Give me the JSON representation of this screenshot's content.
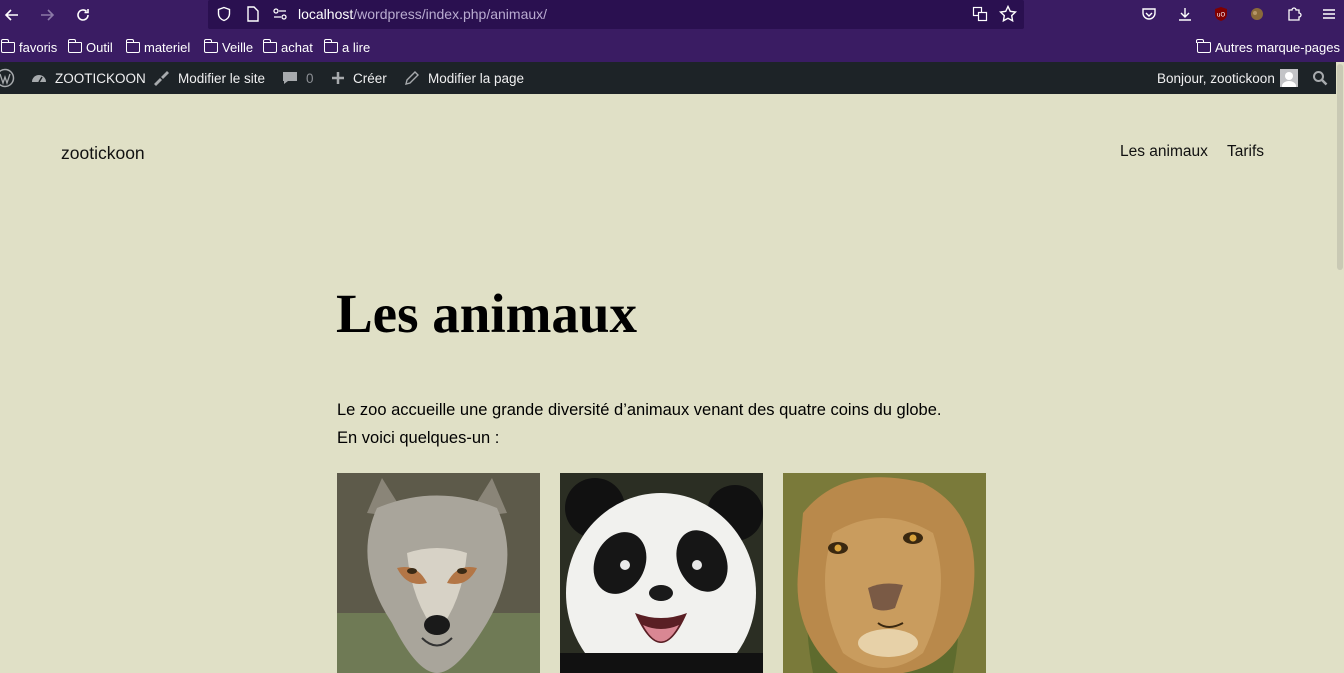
{
  "browser": {
    "url_host": "localhost",
    "url_path": "/wordpress/index.php/animaux/",
    "bookmarks": [
      "favoris",
      "Outil",
      "materiel",
      "Veille",
      "achat",
      "a lire"
    ],
    "other_bookmarks": "Autres marque-pages"
  },
  "adminbar": {
    "site_name": "ZOOTICKOON",
    "edit_site": "Modifier le site",
    "comments_count": "0",
    "new": "Créer",
    "edit_page": "Modifier la page",
    "greeting": "Bonjour, zootickoon"
  },
  "site": {
    "title": "zootickoon",
    "nav": [
      "Les animaux",
      "Tarifs"
    ]
  },
  "page": {
    "title": "Les animaux",
    "intro_line1": "Le zoo accueille une grande diversité d’animaux venant des quatre coins du globe.",
    "intro_line2": "En voici quelques-un :",
    "gallery": [
      "wolf-photo",
      "panda-photo",
      "lion-photo"
    ]
  },
  "colors": {
    "browser_chrome": "#3a1c63",
    "adminbar": "#1d2327",
    "page_background": "#e0e0c6"
  }
}
